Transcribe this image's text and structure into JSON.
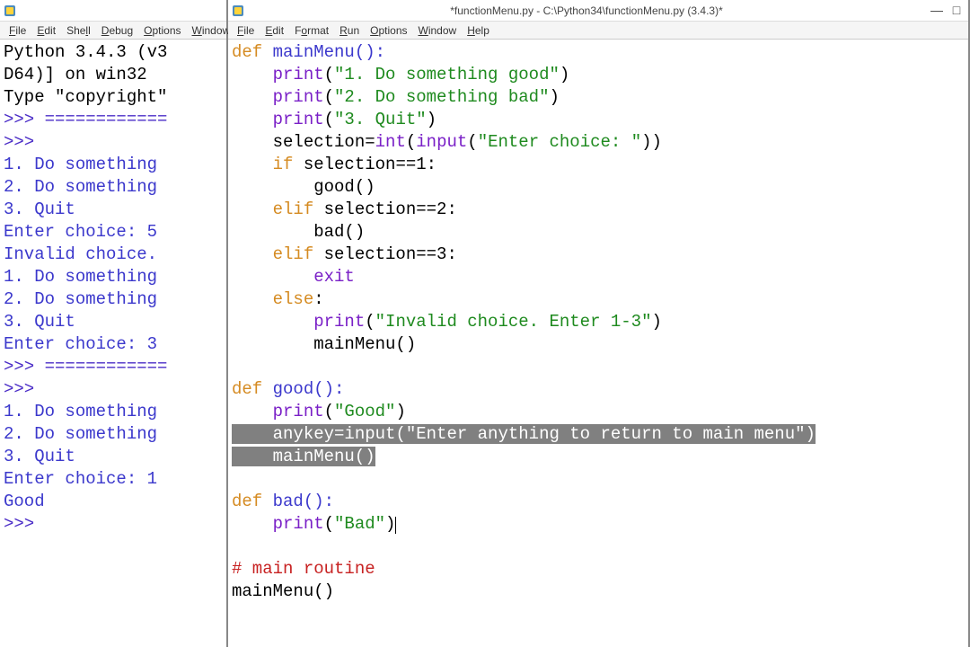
{
  "left": {
    "menus": [
      "File",
      "Edit",
      "Shell",
      "Debug",
      "Options",
      "Window"
    ],
    "header1": "Python 3.4.3 (v3",
    "header2": "D64)] on win32",
    "header3": "Type \"copyright\"",
    "promptsep": ">>> ============",
    "prompt": ">>> ",
    "menu1": "1. Do something",
    "menu2": "2. Do something",
    "menu3": "3. Quit",
    "enter5": "Enter choice: 5",
    "invalid": "Invalid choice.",
    "enter3": "Enter choice: 3",
    "enter1": "Enter choice: 1",
    "good": "Good"
  },
  "right": {
    "title": "*functionMenu.py - C:\\Python34\\functionMenu.py (3.4.3)*",
    "menus": [
      "File",
      "Edit",
      "Format",
      "Run",
      "Options",
      "Window",
      "Help"
    ],
    "minimize": "—",
    "line1": {
      "def": "def",
      "name": " mainMenu():"
    },
    "line2": {
      "print": "print",
      "open": "(",
      "str": "\"1. Do something good\"",
      "close": ")"
    },
    "line3": {
      "print": "print",
      "open": "(",
      "str": "\"2. Do something bad\"",
      "close": ")"
    },
    "line4": {
      "print": "print",
      "open": "(",
      "str": "\"3. Quit\"",
      "close": ")"
    },
    "line5": {
      "pre": "    selection=",
      "int": "int",
      "open": "(",
      "input": "input",
      "open2": "(",
      "str": "\"Enter choice: \"",
      "close": "))"
    },
    "line6": {
      "if": "if",
      "rest": " selection==1:"
    },
    "line7": "        good()",
    "line8": {
      "elif": "elif",
      "rest": " selection==2:"
    },
    "line9": "        bad()",
    "line10": {
      "elif": "elif",
      "rest": " selection==3:"
    },
    "line11": {
      "pre": "        ",
      "exit": "exit"
    },
    "line12": {
      "else": "else",
      "colon": ":"
    },
    "line13": {
      "pre": "        ",
      "print": "print",
      "open": "(",
      "str": "\"Invalid choice. Enter 1-3\"",
      "close": ")"
    },
    "line14": "        mainMenu()",
    "line16": {
      "def": "def",
      "name": " good():"
    },
    "line17": {
      "pre": "    ",
      "print": "print",
      "open": "(",
      "str": "\"Good\"",
      "close": ")"
    },
    "line18": {
      "pre": "    anykey=",
      "input": "input",
      "open": "(",
      "str": "\"Enter anything to return to main menu\"",
      "close": ")"
    },
    "line19": "    mainMenu()",
    "line21": {
      "def": "def",
      "name": " bad():"
    },
    "line22": {
      "pre": "    ",
      "print": "print",
      "open": "(",
      "str": "\"Bad\"",
      "close": ")"
    },
    "line24": "# main routine",
    "line25": "mainMenu()"
  }
}
